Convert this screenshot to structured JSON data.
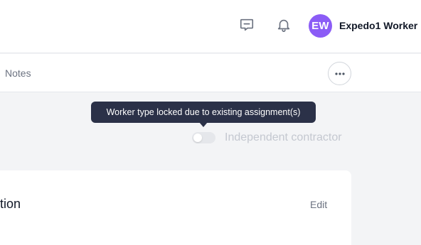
{
  "header": {
    "user": {
      "initials": "EW",
      "name": "Expedo1 Worker",
      "avatar_color": "#8b5cf6"
    },
    "icons": {
      "chat": "message-square-icon",
      "notifications": "bell-icon"
    }
  },
  "tabs": {
    "notes_label": "Notes",
    "more_icon": "ellipsis-icon"
  },
  "worker_type": {
    "tooltip": "Worker type locked due to existing assignment(s)",
    "toggle_label": "Independent contractor",
    "toggle_on": false
  },
  "card": {
    "title_fragment": "tion",
    "edit_label": "Edit"
  }
}
